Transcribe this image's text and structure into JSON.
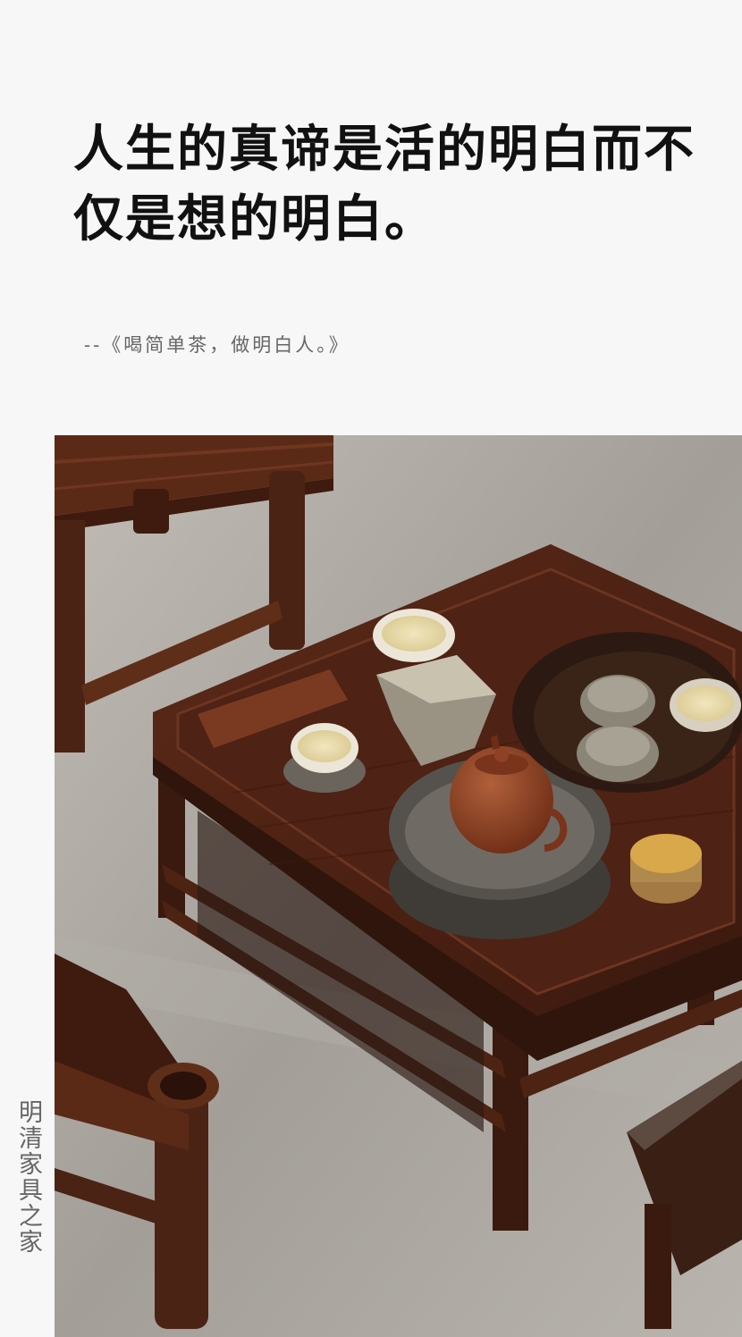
{
  "headline": "人生的真谛是活的明白而不仅是想的明白。",
  "quote_source": "--《喝简单茶，做明白人。》",
  "brand_vertical": "明清家具之家",
  "photo": {
    "subject": "photo-tea-table",
    "colors": {
      "floor": "#a8a39d",
      "wood_dark": "#3b1d12",
      "wood_mid": "#5a2c1a",
      "clay_teapot": "#8a3f22",
      "tea_liquor": "#e9dcae",
      "stone_tray": "#55524d"
    }
  }
}
